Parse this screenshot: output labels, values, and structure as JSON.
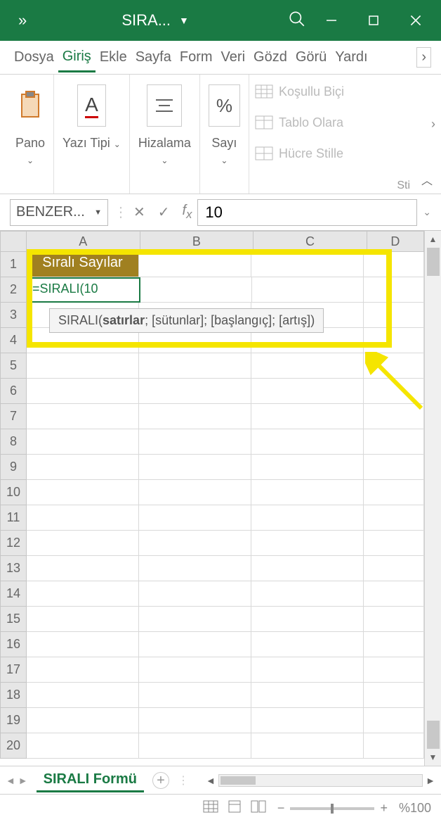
{
  "titlebar": {
    "title": "SIRA..."
  },
  "tabs": [
    "Dosya",
    "Giriş",
    "Ekle",
    "Sayfa",
    "Form",
    "Veri",
    "Gözd",
    "Görü",
    "Yardı"
  ],
  "active_tab": 1,
  "ribbon": {
    "pano": "Pano",
    "yazi": "Yazı Tipi",
    "hizalama": "Hizalama",
    "sayi": "Sayı",
    "kosullu": "Koşullu Biçi",
    "tablo": "Tablo Olara",
    "hucre": "Hücre Stille",
    "sti": "Sti"
  },
  "namebox": "BENZER...",
  "formula_value": "10",
  "columns": [
    "A",
    "B",
    "C",
    "D"
  ],
  "row_count": 20,
  "cell_a1": "Sıralı Sayılar",
  "cell_a2": "=SIRALI(10",
  "tooltip": {
    "fn": "SIRALI(",
    "arg1": "satırlar",
    "rest": "; [sütunlar]; [başlangıç]; [artış])"
  },
  "sheet_name": "SIRALI Formü",
  "zoom": "%100"
}
